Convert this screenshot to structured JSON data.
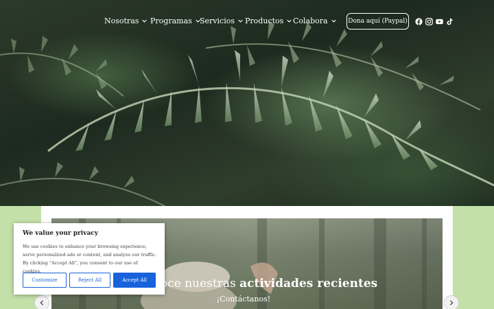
{
  "nav": {
    "items": [
      {
        "label": "Nosotras"
      },
      {
        "label": "Programas"
      },
      {
        "label": "Servicios"
      },
      {
        "label": "Productos"
      },
      {
        "label": "Colabora"
      }
    ],
    "donate_label": "Dona aquí (Paypal)",
    "social": [
      "facebook-icon",
      "instagram-icon",
      "youtube-icon",
      "tiktok-icon"
    ]
  },
  "slider": {
    "title_light": "Conoce nuestras",
    "title_bold": "actividades recientes",
    "subtitle": "¡Contáctanos!"
  },
  "cookie": {
    "title": "We value your privacy",
    "text": "We use cookies to enhance your browsing experience, serve personalized ads or content, and analyze our traffic. By clicking \"Accept All\", you consent to our use of cookies.",
    "customize_label": "Customize",
    "reject_label": "Reject All",
    "accept_label": "Accept All"
  },
  "colors": {
    "accent": "#1863dc",
    "page_bg": "#c3e0a9"
  }
}
